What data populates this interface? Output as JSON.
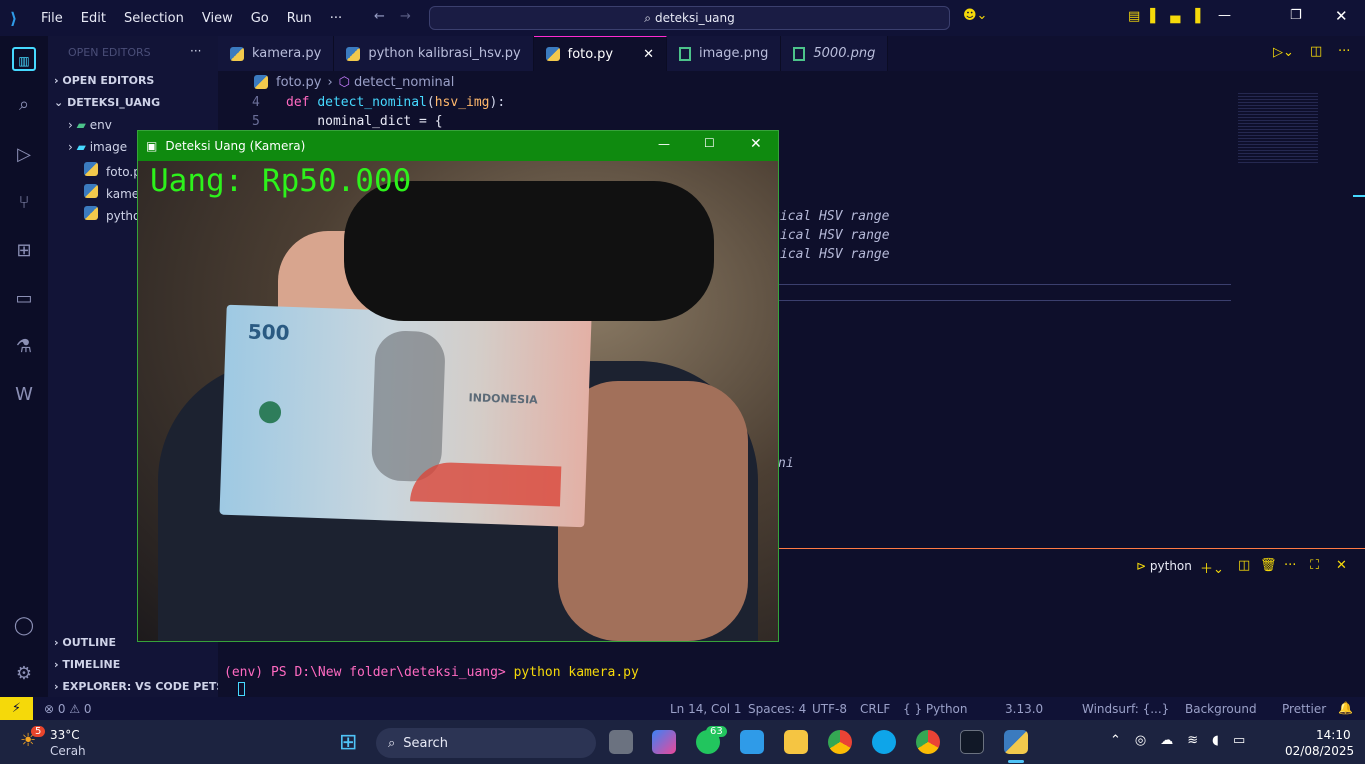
{
  "menu": [
    "File",
    "Edit",
    "Selection",
    "View",
    "Go",
    "Run",
    "···"
  ],
  "search": {
    "text": "deteksi_uang"
  },
  "sidebar": {
    "header": "OPEN EDITORS",
    "open_editors": "OPEN EDITORS",
    "folder": "DETEKSI_UANG",
    "items": [
      "env",
      "image",
      "foto.py",
      "kamera",
      "pytho"
    ],
    "outline": "OUTLINE",
    "timeline": "TIMELINE",
    "pets": "EXPLORER: VS CODE PETS"
  },
  "tabs": [
    "kamera.py",
    "python kalibrasi_hsv.py",
    "foto.py",
    "image.png",
    "5000.png"
  ],
  "breadcrumb": {
    "file": "foto.py",
    "symbol": "detect_nominal"
  },
  "code": {
    "ln4": "4",
    "ln5": "5",
    "l4_def": "def ",
    "l4_fn": "detect_nominal",
    "l4_p1": "(",
    "l4_param": "hsv_img",
    "l4_p2": "):",
    "l5": "    nominal_dict = {",
    "c1": "tical HSV range",
    "c2": "ical HSV range",
    "c3": "ical HSV range",
    "c4": "ni"
  },
  "terminal": {
    "tab": "python",
    "prompt": "(env) PS D:\\New folder\\deteksi_uang> ",
    "cmd": "python kamera.py"
  },
  "status": {
    "errors": "0",
    "warnings": "0",
    "ln": "Ln 14, Col 1",
    "spaces": "Spaces: 4",
    "enc": "UTF-8",
    "eol": "CRLF",
    "lang": "{ } Python",
    "ver": "3.13.0",
    "windsurf": "Windsurf: {...}",
    "bg": "Background",
    "prettier": "Prettier"
  },
  "camera": {
    "title": "Deteksi Uang (Kamera)",
    "overlay": "Uang: Rp50.000",
    "note_text": "500",
    "note_brand": "INDONESIA"
  },
  "taskbar": {
    "temp": "33°C",
    "weather": "Cerah",
    "weather_badge": "5",
    "search": "Search",
    "whatsapp_badge": "63",
    "time": "14:10",
    "date": "02/08/2025"
  }
}
